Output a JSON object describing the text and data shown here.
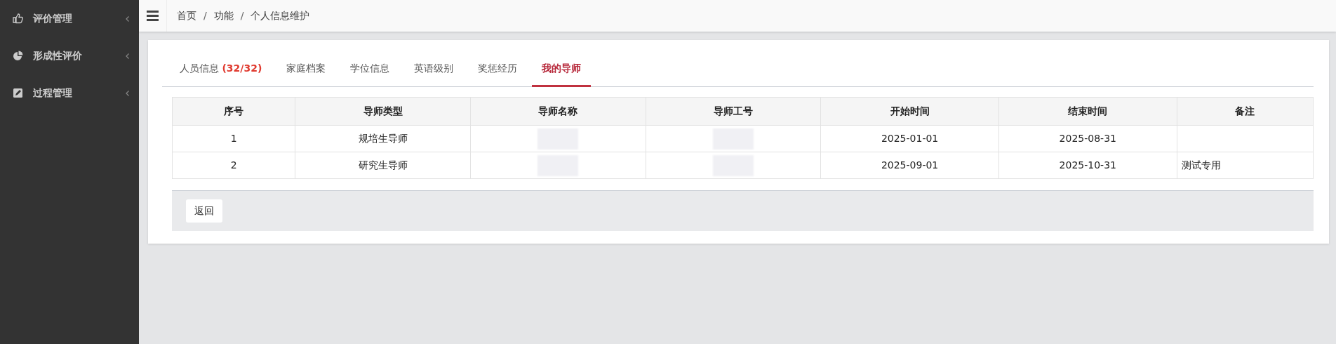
{
  "sidebar": {
    "items": [
      {
        "label": "评价管理",
        "kind": "thumb"
      },
      {
        "label": "形成性评价",
        "kind": "pie"
      },
      {
        "label": "过程管理",
        "kind": "edit"
      }
    ]
  },
  "breadcrumb": [
    {
      "kind": "link",
      "text": "首页"
    },
    {
      "kind": "separator",
      "text": "/"
    },
    {
      "kind": "link",
      "text": "功能"
    },
    {
      "kind": "separator",
      "text": "/"
    },
    {
      "kind": "link",
      "text": "个人信息维护"
    }
  ],
  "tabs": [
    {
      "label": "人员信息",
      "count": "(32/32)",
      "selected": false
    },
    {
      "label": "家庭档案",
      "selected": false
    },
    {
      "label": "学位信息",
      "selected": false
    },
    {
      "label": "英语级别",
      "selected": false
    },
    {
      "label": "奖惩经历",
      "selected": false
    },
    {
      "label": "我的导师",
      "selected": true
    }
  ],
  "table": {
    "columns": [
      "序号",
      "导师类型",
      "导师名称",
      "导师工号",
      "开始时间",
      "结束时间",
      "备注"
    ],
    "rows": [
      {
        "cells": [
          "1",
          "规培生导师",
          null,
          null,
          "2025-01-01",
          "2025-08-31",
          ""
        ]
      },
      {
        "cells": [
          "2",
          "研究生导师",
          null,
          null,
          "2025-09-01",
          "2025-10-31",
          "测试专用"
        ]
      }
    ]
  },
  "buttons": [
    "返回"
  ]
}
